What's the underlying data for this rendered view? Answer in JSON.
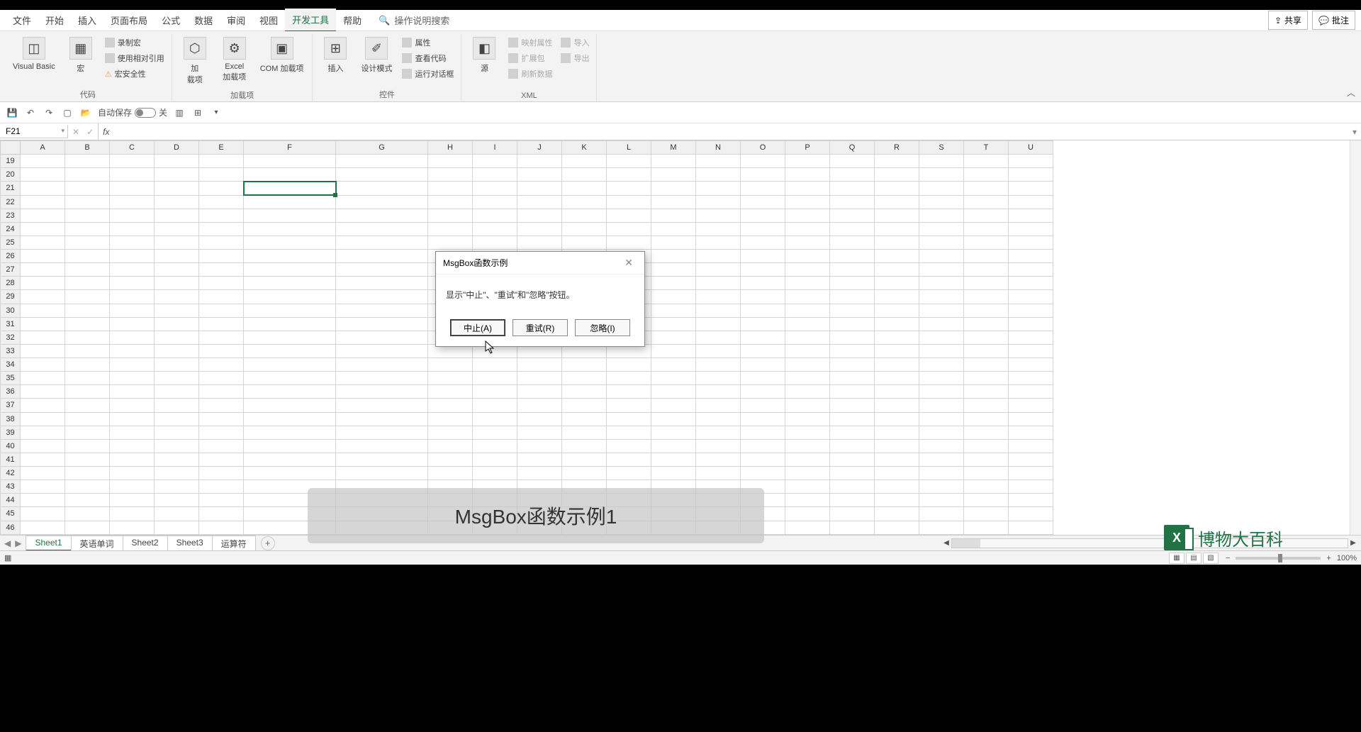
{
  "menu": {
    "tabs": [
      "文件",
      "开始",
      "插入",
      "页面布局",
      "公式",
      "数据",
      "审阅",
      "视图",
      "开发工具",
      "帮助"
    ],
    "active": "开发工具",
    "search_placeholder": "操作说明搜索",
    "share": "共享",
    "comments": "批注"
  },
  "ribbon": {
    "groups": {
      "code": {
        "label": "代码",
        "visual_basic": "Visual Basic",
        "macros": "宏",
        "record_macro": "录制宏",
        "use_relative": "使用相对引用",
        "macro_security": "宏安全性"
      },
      "addins": {
        "label": "加载项",
        "addins": "加\n载项",
        "excel_addins": "Excel\n加载项",
        "com_addins": "COM 加载项"
      },
      "controls": {
        "label": "控件",
        "insert": "插入",
        "design_mode": "设计模式",
        "properties": "属性",
        "view_code": "查看代码",
        "run_dialog": "运行对话框"
      },
      "xml": {
        "label": "XML",
        "source": "源",
        "map_props": "映射属性",
        "expansion": "扩展包",
        "refresh": "刷新数据",
        "import": "导入",
        "export": "导出"
      }
    }
  },
  "quick_access": {
    "autosave_label": "自动保存",
    "autosave_state": "关"
  },
  "formula_bar": {
    "cell_ref": "F21",
    "fx": "fx",
    "value": ""
  },
  "grid": {
    "columns": [
      "A",
      "B",
      "C",
      "D",
      "E",
      "F",
      "G",
      "H",
      "I",
      "J",
      "K",
      "L",
      "M",
      "N",
      "O",
      "P",
      "Q",
      "R",
      "S",
      "T",
      "U"
    ],
    "row_start": 19,
    "row_end": 46,
    "selected_cell": "F21"
  },
  "sheets": {
    "tabs": [
      "Sheet1",
      "英语单词",
      "Sheet2",
      "Sheet3",
      "运算符"
    ],
    "active": "Sheet1"
  },
  "status": {
    "zoom": "100%"
  },
  "dialog": {
    "title": "MsgBox函数示例",
    "message": "显示\"中止\"、\"重试\"和\"忽略\"按钮。",
    "abort": "中止(A)",
    "retry": "重试(R)",
    "ignore": "忽略(I)"
  },
  "caption": "MsgBox函数示例1",
  "watermark": "博物大百科"
}
